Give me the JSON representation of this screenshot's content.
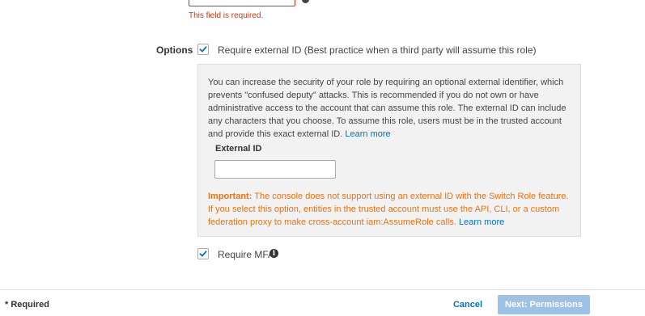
{
  "account": {
    "error": "This field is required."
  },
  "options": {
    "label": "Options",
    "require_external_id": {
      "checked": true,
      "label": "Require external ID (Best practice when a third party will assume this role)"
    },
    "info_box": {
      "description": "You can increase the security of your role by requiring an optional external identifier, which prevents \"confused deputy\" attacks. This is recommended if you do not own or have administrative access to the account that can assume this role. The external ID can include any characters that you choose. To assume this role, users must be in the trusted account and provide this exact external ID.",
      "learn_more": "Learn more",
      "external_id_label": "External ID",
      "external_id_value": "",
      "important_label": "Important:",
      "important_text": "The console does not support using an external ID with the Switch Role feature. If you select this option, entities in the trusted account must use the API, CLI, or a custom federation proxy to make cross-account iam:AssumeRole calls.",
      "important_learn_more": "Learn more"
    },
    "require_mfa": {
      "checked": true,
      "label": "Require MFA"
    }
  },
  "footer": {
    "required_note": "* Required",
    "cancel": "Cancel",
    "next": "Next: Permissions"
  },
  "colors": {
    "error": "#d13212",
    "link": "#0073bb",
    "warning": "#ec7211",
    "primary_disabled": "#9ec1e6"
  },
  "icons": [
    "checkmark-icon",
    "info-icon",
    "help-icon"
  ]
}
